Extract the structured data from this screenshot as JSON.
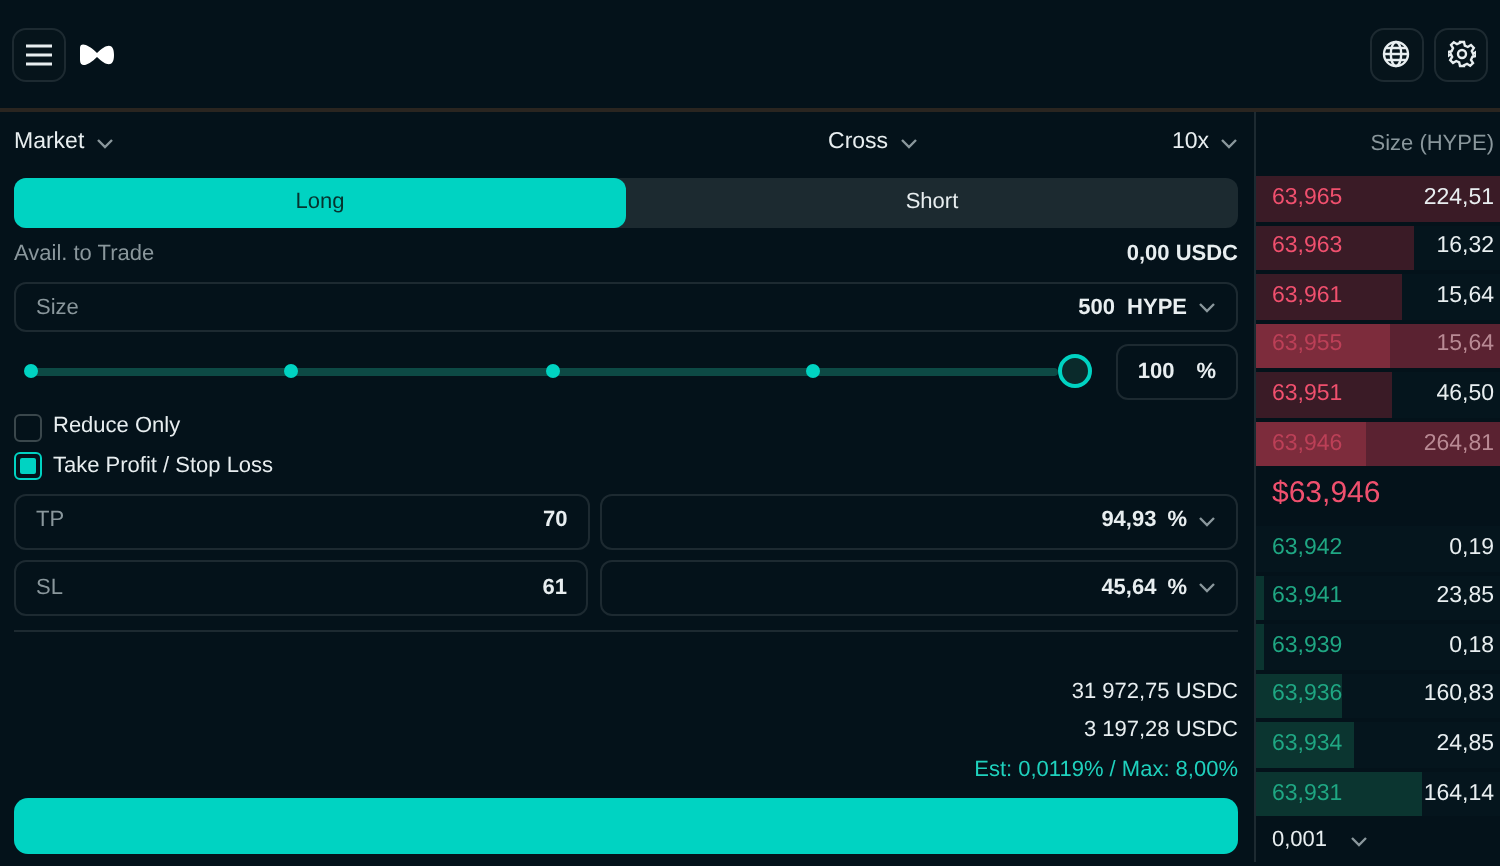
{
  "order_form": {
    "order_type": "Market",
    "margin_mode": "Cross",
    "leverage": "10x",
    "sides": [
      {
        "label": "Long",
        "selected": true
      },
      {
        "label": "Short",
        "selected": false
      }
    ],
    "available": {
      "label": "Avail. to Trade",
      "value": "0,00 USDC"
    },
    "size": {
      "label": "Size",
      "value": "500",
      "unit": "HYPE"
    },
    "slider": {
      "level": 1,
      "percent": "100",
      "unit": "%"
    },
    "options": [
      {
        "label": "Reduce Only",
        "checked": false
      },
      {
        "label": "Take Profit / Stop Loss",
        "checked": true
      }
    ],
    "tpsl": [
      {
        "label": "TP",
        "price": "70",
        "gain": "94,93",
        "unit": "%"
      },
      {
        "label": "SL",
        "price": "61",
        "gain": "45,64",
        "unit": "%"
      }
    ],
    "summary": [
      "31 972,75 USDC",
      "3 197,28 USDC"
    ],
    "slippage": "Est: 0,0119% / Max: 8,00%"
  },
  "order_book": {
    "size_header": "Size (HYPE)",
    "asks": [
      {
        "price": "63,965",
        "size": "224,51",
        "level": 1,
        "highlighted": false
      },
      {
        "price": "63,963",
        "size": "16,32",
        "level": 0.65,
        "highlighted": false
      },
      {
        "price": "63,961",
        "size": "15,64",
        "level": 0.6,
        "highlighted": false
      },
      {
        "price": "63,955",
        "size": "15,64",
        "level": 0.55,
        "highlighted": true
      },
      {
        "price": "63,951",
        "size": "46,50",
        "level": 0.56,
        "highlighted": false
      },
      {
        "price": "63,946",
        "size": "264,81",
        "level": 0.45,
        "highlighted": true
      }
    ],
    "mid_price": "$63,946",
    "bids": [
      {
        "price": "63,942",
        "size": "0,19"
      },
      {
        "price": "63,941",
        "size": "23,85",
        "level": 0.03
      },
      {
        "price": "63,939",
        "size": "0,18",
        "level": 0.03
      },
      {
        "price": "63,936",
        "size": "160,83",
        "level": 0.35
      },
      {
        "price": "63,934",
        "size": "24,85",
        "level": 0.4
      },
      {
        "price": "63,931",
        "size": "164,14",
        "level": 0.68
      }
    ],
    "tick": "0,001"
  }
}
